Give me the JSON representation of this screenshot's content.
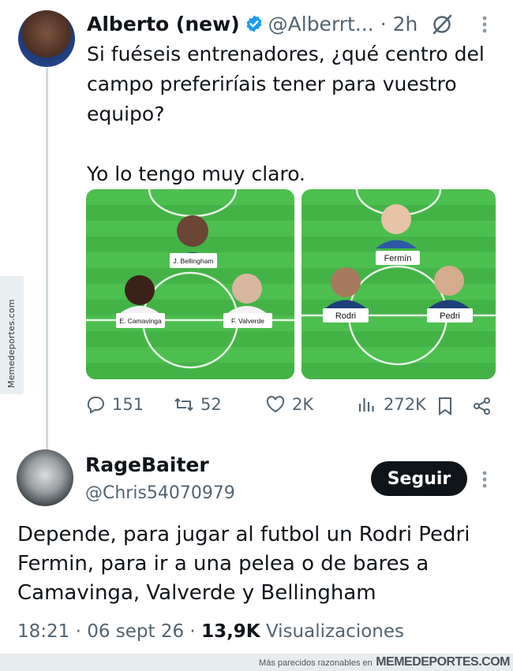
{
  "watermark": {
    "side_text": "Memedeportes.com",
    "footer_small": "Más parecidos razonables en",
    "footer_brand": "MEMEDEPORTES.COM"
  },
  "tweet": {
    "author_name": "Alberto (new)",
    "handle": "@Alberrt...",
    "time": "· 2h",
    "text": "Si fuéseis entrenadores, ¿qué centro del campo preferiríais tener para vuestro equipo?\n\nYo lo tengo muy claro.",
    "lineup_left": [
      "J. Bellingham",
      "E. Camavinga",
      "F. Valverde"
    ],
    "lineup_right": [
      "Fermín",
      "Rodri",
      "Pedri"
    ],
    "stats": {
      "replies": "151",
      "retweets": "52",
      "likes": "2K",
      "views": "272K"
    }
  },
  "reply": {
    "author_name": "RageBaiter",
    "handle": "@Chris54070979",
    "follow_label": "Seguir",
    "text": "Depende, para jugar al futbol un Rodri Pedri Fermin, para ir a una pelea o de bares a Camavinga, Valverde y Bellingham",
    "time": "18:21 · 06 sept 26 ·",
    "views_count": "13,9K",
    "views_label": "Visualizaciones"
  },
  "colors": {
    "pitch_light": "#4cbf4f",
    "pitch_dark": "#44b347",
    "verified_blue": "#1d9bf0",
    "text_muted": "#536471"
  },
  "icons": [
    "verified-icon",
    "grok-icon",
    "more-icon",
    "reply-icon",
    "retweet-icon",
    "like-icon",
    "views-icon",
    "bookmark-icon",
    "share-icon"
  ]
}
